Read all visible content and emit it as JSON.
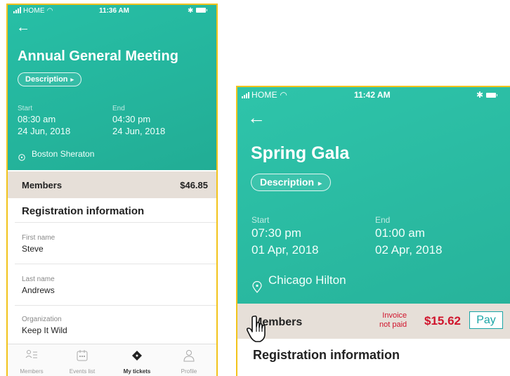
{
  "screen1": {
    "status": {
      "carrier": "HOME",
      "time": "11:36 AM"
    },
    "title": "Annual General Meeting",
    "description_label": "Description",
    "start_label": "Start",
    "start_time": "08:30 am",
    "start_date": "24 Jun, 2018",
    "end_label": "End",
    "end_time": "04:30 pm",
    "end_date": "24 Jun, 2018",
    "location": "Boston Sheraton",
    "members_label": "Members",
    "members_price": "$46.85",
    "registration_heading": "Registration information",
    "fields": [
      {
        "label": "First name",
        "value": "Steve"
      },
      {
        "label": "Last name",
        "value": "Andrews"
      },
      {
        "label": "Organization",
        "value": "Keep It Wild"
      }
    ],
    "tabs": [
      {
        "label": "Members",
        "icon": "members-icon"
      },
      {
        "label": "Events list",
        "icon": "calendar-icon"
      },
      {
        "label": "My tickets",
        "icon": "ticket-icon",
        "active": true
      },
      {
        "label": "Profile",
        "icon": "profile-icon"
      }
    ]
  },
  "screen2": {
    "status": {
      "carrier": "HOME",
      "time": "11:42 AM"
    },
    "title": "Spring Gala",
    "description_label": "Description",
    "start_label": "Start",
    "start_time": "07:30 pm",
    "start_date": "01 Apr, 2018",
    "end_label": "End",
    "end_time": "01:00 am",
    "end_date": "02 Apr, 2018",
    "location": "Chicago Hilton",
    "members_label": "Members",
    "invoice_line1": "Invoice",
    "invoice_line2": "not paid",
    "members_price": "$15.62",
    "pay_label": "Pay",
    "registration_heading": "Registration information"
  },
  "colors": {
    "teal": "#27bfa6",
    "accent_frame": "#f2c31b",
    "alert_red": "#d0142c",
    "pay_teal": "#1aa5a6",
    "members_band": "#e6dfd8"
  }
}
